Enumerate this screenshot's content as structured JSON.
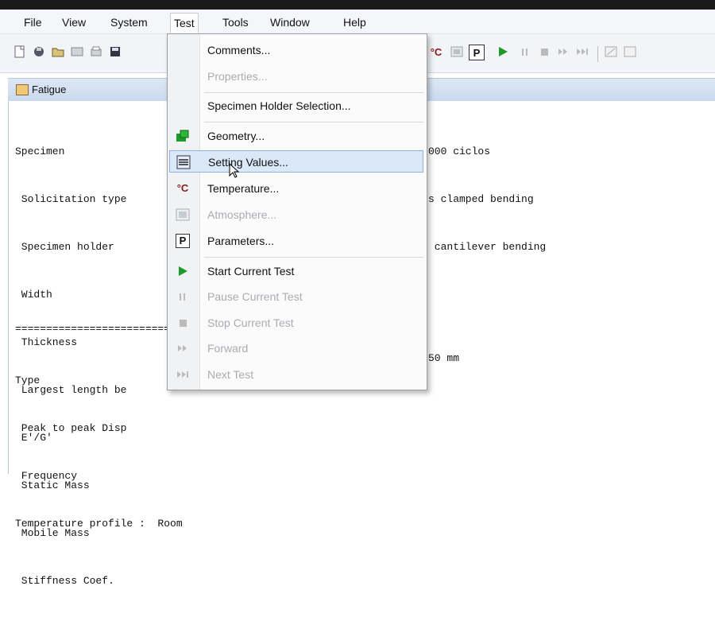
{
  "menubar": {
    "items": [
      "File",
      "View",
      "System",
      "Test",
      "Tools",
      "Window",
      "Help"
    ]
  },
  "toolbar": {
    "icons_left": [
      "new-icon",
      "open-icon",
      "folder-icon",
      "save-all-icon",
      "print-icon",
      "save-icon"
    ],
    "icons_right": [
      "temperature-icon",
      "atmosphere-icon",
      "parameters-icon",
      "play-icon",
      "pause-icon",
      "stop-icon",
      "forward-icon",
      "next-icon",
      "chart-icon",
      "chart2-icon"
    ],
    "temp_label": "°C",
    "param_label": "P"
  },
  "child_window": {
    "title": "Fatigue"
  },
  "report": {
    "lines_left": [
      "Specimen",
      " Solicitation type",
      " Specimen holder",
      " Width",
      " Thickness",
      " Largest length be",
      " E'/G'",
      " Static Mass",
      " Mobile Mass",
      " Stiffness Coef."
    ],
    "lines_right": [
      "000 ciclos",
      "s clamped bending",
      " cantilever bending",
      "",
      "",
      "50 mm",
      "",
      "",
      "",
      ""
    ],
    "separator": "==========================",
    "lines_lower": [
      "Type",
      " Peak to peak Disp",
      " Frequency",
      "Temperature profile :  Room"
    ]
  },
  "dropdown": {
    "items": [
      {
        "label": "Comments...",
        "icon": "",
        "enabled": true
      },
      {
        "label": "Properties...",
        "icon": "",
        "enabled": false
      },
      {
        "label": "Specimen Holder Selection...",
        "icon": "",
        "enabled": true
      },
      {
        "label": "Geometry...",
        "icon": "geometry-icon",
        "enabled": true
      },
      {
        "label": "Setting Values...",
        "icon": "setting-values-icon",
        "enabled": true,
        "highlighted": true
      },
      {
        "label": "Temperature...",
        "icon": "temperature-icon",
        "enabled": true
      },
      {
        "label": "Atmosphere...",
        "icon": "atmosphere-icon",
        "enabled": false
      },
      {
        "label": "Parameters...",
        "icon": "parameters-icon",
        "enabled": true
      },
      {
        "label": "Start Current Test",
        "icon": "play-icon",
        "enabled": true
      },
      {
        "label": "Pause Current Test",
        "icon": "pause-icon",
        "enabled": false
      },
      {
        "label": "Stop Current Test",
        "icon": "stop-icon",
        "enabled": false
      },
      {
        "label": "Forward",
        "icon": "forward-icon",
        "enabled": false
      },
      {
        "label": "Next Test",
        "icon": "next-icon",
        "enabled": false
      }
    ]
  },
  "colors": {
    "accent_green": "#1e9a2a",
    "highlight": "#dbe8f7",
    "disabled_text": "#a8acb2"
  }
}
